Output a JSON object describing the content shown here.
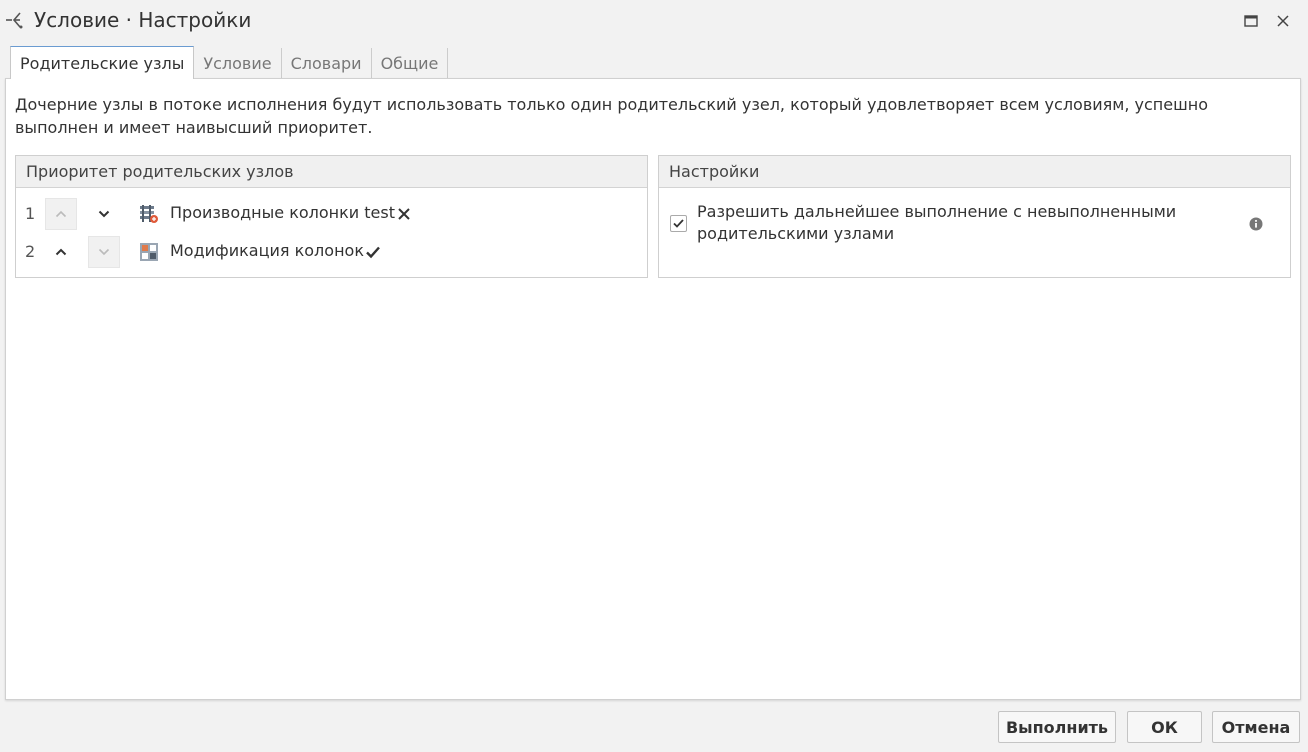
{
  "window": {
    "title": "Условие · Настройки",
    "icon": "condition-node-icon",
    "controls": [
      "maximize-icon",
      "close-icon"
    ]
  },
  "tabs": [
    {
      "label": "Родительские узлы",
      "active": true
    },
    {
      "label": "Условие",
      "active": false
    },
    {
      "label": "Словари",
      "active": false
    },
    {
      "label": "Общие",
      "active": false
    }
  ],
  "description": "Дочерние узлы в потоке исполнения будут использовать только один родительский узел, который удовлетворяет всем условиям, успешно выполнен и имеет наивысший приоритет.",
  "priority_panel": {
    "title": "Приоритет родительских узлов",
    "rows": [
      {
        "number": "1",
        "label": "Производные колонки test",
        "status": "error",
        "status_icon": "cross-icon",
        "up_disabled": true,
        "down_disabled": false
      },
      {
        "number": "2",
        "label": "Модификация колонок",
        "status": "success",
        "status_icon": "check-icon",
        "up_disabled": false,
        "down_disabled": true
      }
    ]
  },
  "settings_panel": {
    "title": "Настройки",
    "checkbox_label": "Разрешить дальнейшее выполнение с невыполненными родительскими узлами",
    "checked": true,
    "info_icon": "info-icon"
  },
  "footer": {
    "run_label": "Выполнить",
    "ok_label": "ОК",
    "cancel_label": "Отмена"
  },
  "colors": {
    "active_tab_border": "#6a9bd1",
    "panel_header_bg": "#f0f0f0",
    "window_bg": "#f2f2f2"
  }
}
